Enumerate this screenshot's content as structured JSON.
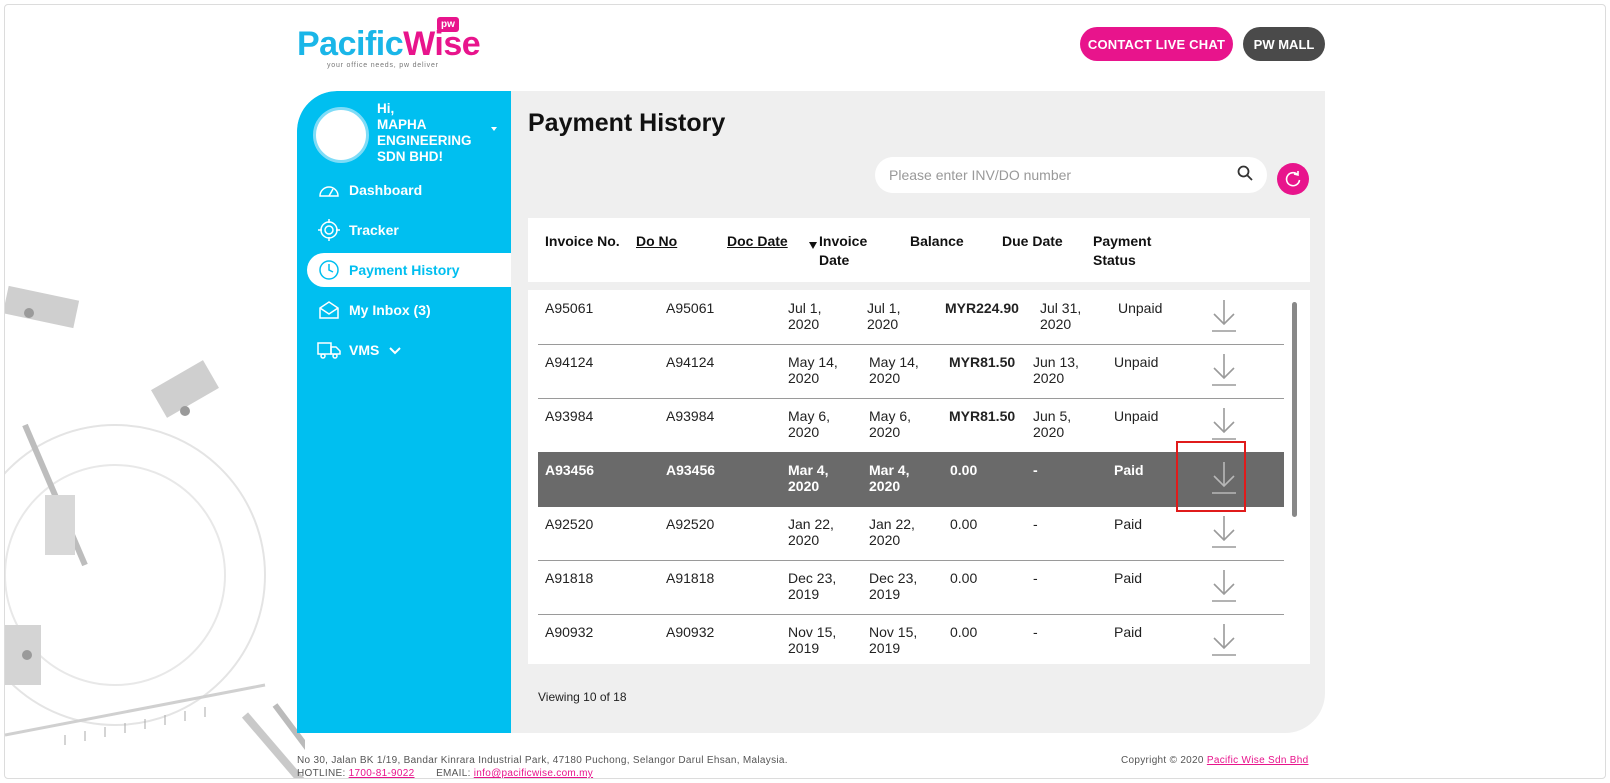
{
  "header": {
    "logo_text_1": "Pac",
    "logo_text_1b": "ific",
    "logo_text_2": "Wise",
    "logo_badge": "pw",
    "logo_tagline": "your office needs, pw deliver",
    "contact_button": "CONTACT LIVE CHAT",
    "mall_button": "PW MALL"
  },
  "sidebar": {
    "greeting_hi": "Hi,",
    "greeting_name": "MAPHA ENGINEERING SDN BHD!",
    "items": [
      {
        "label": "Dashboard",
        "icon": "gauge-icon"
      },
      {
        "label": "Tracker",
        "icon": "target-icon"
      },
      {
        "label": "Payment History",
        "icon": "clock-icon"
      },
      {
        "label": "My Inbox (3)",
        "icon": "envelope-icon"
      },
      {
        "label": "VMS",
        "icon": "truck-icon"
      }
    ]
  },
  "main": {
    "title": "Payment History",
    "search": {
      "placeholder": "Please enter INV/DO number",
      "value": ""
    },
    "columns": {
      "invoice_no": "Invoice No.",
      "do_no": "Do No",
      "doc_date": "Doc Date",
      "invoice_date_1": "Invoice",
      "invoice_date_2": "Date",
      "balance": "Balance",
      "due_date": "Due Date",
      "status_1": "Payment",
      "status_2": "Status"
    },
    "rows": [
      {
        "inv": "A95061",
        "do": "A95061",
        "doc_1": "Jul 1,",
        "doc_2": "2020",
        "invd_1": "Jul 1,",
        "invd_2": "2020",
        "balance": "MYR224.90",
        "due_1": "Jul 31,",
        "due_2": "2020",
        "status": "Unpaid"
      },
      {
        "inv": "A94124",
        "do": "A94124",
        "doc_1": "May 14,",
        "doc_2": "2020",
        "invd_1": "May 14,",
        "invd_2": "2020",
        "balance": "MYR81.50",
        "due_1": "Jun 13,",
        "due_2": "2020",
        "status": "Unpaid"
      },
      {
        "inv": "A93984",
        "do": "A93984",
        "doc_1": "May 6,",
        "doc_2": "2020",
        "invd_1": "May 6,",
        "invd_2": "2020",
        "balance": "MYR81.50",
        "due_1": "Jun 5,",
        "due_2": "2020",
        "status": "Unpaid"
      },
      {
        "inv": "A93456",
        "do": "A93456",
        "doc_1": "Mar 4,",
        "doc_2": "2020",
        "invd_1": "Mar 4,",
        "invd_2": "2020",
        "balance": "0.00",
        "due_1": "-",
        "due_2": "",
        "status": "Paid"
      },
      {
        "inv": "A92520",
        "do": "A92520",
        "doc_1": "Jan 22,",
        "doc_2": "2020",
        "invd_1": "Jan 22,",
        "invd_2": "2020",
        "balance": "0.00",
        "due_1": "-",
        "due_2": "",
        "status": "Paid"
      },
      {
        "inv": "A91818",
        "do": "A91818",
        "doc_1": "Dec 23,",
        "doc_2": "2019",
        "invd_1": "Dec 23,",
        "invd_2": "2019",
        "balance": "0.00",
        "due_1": "-",
        "due_2": "",
        "status": "Paid"
      },
      {
        "inv": "A90932",
        "do": "A90932",
        "doc_1": "Nov 15,",
        "doc_2": "2019",
        "invd_1": "Nov 15,",
        "invd_2": "2019",
        "balance": "0.00",
        "due_1": "-",
        "due_2": "",
        "status": "Paid"
      }
    ],
    "viewing": "Viewing 10 of 18"
  },
  "footer": {
    "address": "No 30, Jalan BK 1/19, Bandar Kinrara Industrial Park, 47180 Puchong, Selangor Darul Ehsan, Malaysia.",
    "hotline_label": "HOTLINE:",
    "hotline": "1700-81-9022",
    "email_label": "EMAIL:",
    "email": "info@pacificwise.com.my",
    "copyright": "Copyright © 2020",
    "company": "Pacific Wise Sdn Bhd"
  },
  "colors": {
    "brand_cyan": "#00bff0",
    "brand_pink": "#e8148c",
    "selected_row": "#6a6a6a",
    "highlight": "#e01b1b"
  }
}
